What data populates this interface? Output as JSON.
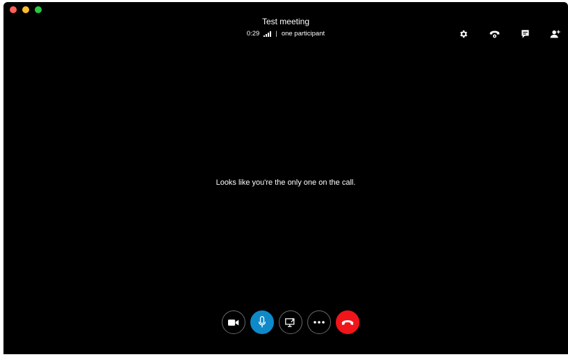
{
  "window": {
    "traffic_lights": {
      "close_color": "#fe5f57",
      "minimize_color": "#febc2e",
      "maximize_color": "#28c840"
    }
  },
  "call": {
    "title": "Test meeting",
    "duration": "0:29",
    "separator": "|",
    "participants": "one participant",
    "empty_message": "Looks like you're the only one on the call."
  },
  "top_actions": [
    {
      "icon": "gear-icon",
      "name": "settings"
    },
    {
      "icon": "phone-icon",
      "name": "dial-pad"
    },
    {
      "icon": "chat-icon",
      "name": "chat"
    },
    {
      "icon": "add-person-icon",
      "name": "add-participant"
    }
  ],
  "controls": [
    {
      "icon": "video-camera-icon",
      "name": "video-toggle"
    },
    {
      "icon": "microphone-icon",
      "name": "mute-toggle",
      "color": "#0e89c9"
    },
    {
      "icon": "screen-share-icon",
      "name": "share-screen"
    },
    {
      "icon": "more-dots-icon",
      "name": "more-options"
    },
    {
      "icon": "hang-up-icon",
      "name": "end-call",
      "color": "#f0151a"
    }
  ]
}
